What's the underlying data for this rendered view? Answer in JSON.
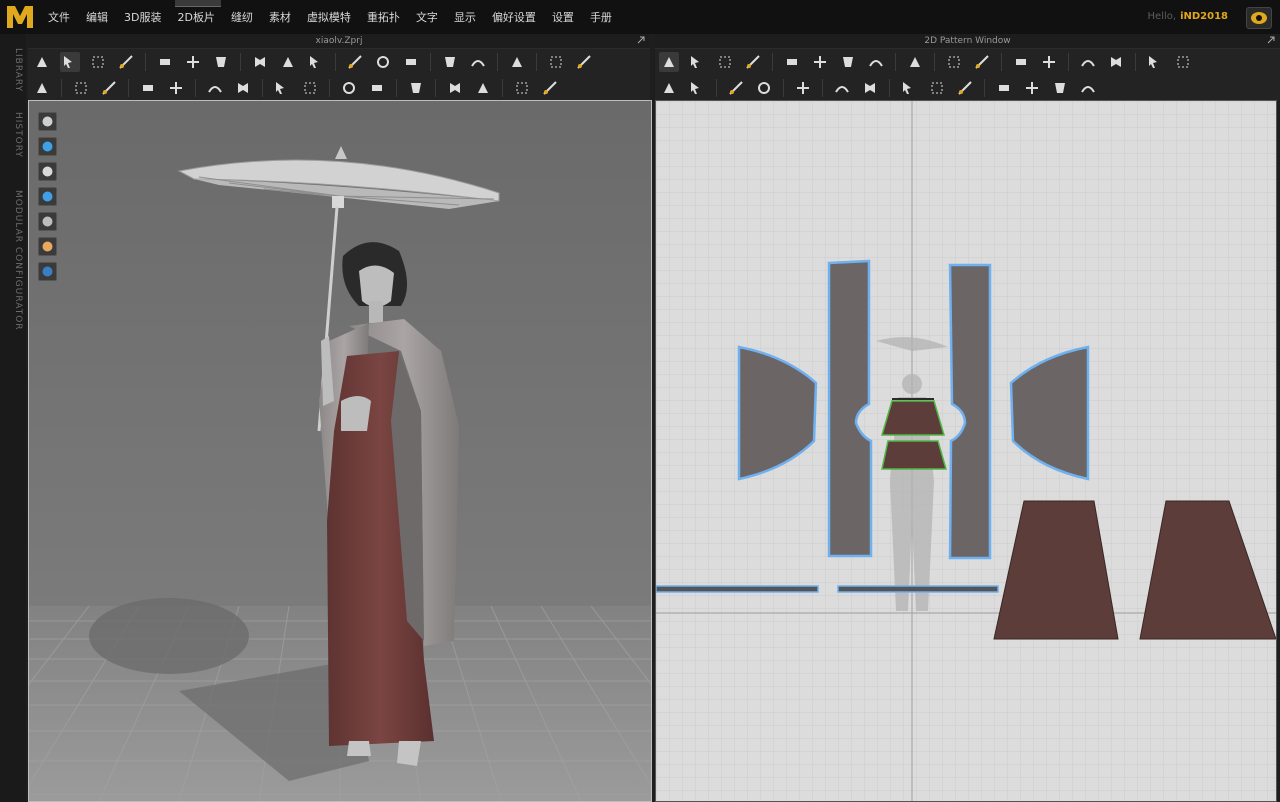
{
  "app": {
    "logo_icon": "marvelous-logo-icon",
    "menu": [
      "文件",
      "编辑",
      "3D服装",
      "2D板片",
      "缝纫",
      "素材",
      "虚拟模特",
      "重拓扑",
      "文字",
      "显示",
      "偏好设置",
      "设置",
      "手册"
    ],
    "greeting": "Hello,",
    "username": "iND2018"
  },
  "sidebar": {
    "tabs": [
      "LIBRARY",
      "HISTORY",
      "MODULAR CONFIGURATOR"
    ]
  },
  "panels": {
    "left_title": "xiaolv.Zprj",
    "right_title": "2D Pattern Window"
  },
  "toolbar_3d": {
    "row1": [
      "select-move",
      "transform-pattern",
      "transform-point",
      "fold-arrangement",
      "_",
      "tack",
      "tack-on-avatar",
      "fold-tack",
      "_",
      "pin-3d",
      "pin-cut",
      "garment-copy",
      "_",
      "strap",
      "tape",
      "steam",
      "_",
      "flat-arrow",
      "flat-sphere",
      "_",
      "edit-fold",
      "_",
      "grid-pattern",
      "grid-line"
    ],
    "row2": [
      "avatar-pose",
      "_",
      "select-mesh",
      "edit-mesh",
      "_",
      "segment",
      "reset-3d",
      "_",
      "lock",
      "hide",
      "_",
      "show-arrangement",
      "show-pins",
      "_",
      "measure",
      "measure-line",
      "_",
      "strength",
      "_",
      "fabric",
      "edit-texture",
      "_",
      "puckering",
      "size"
    ]
  },
  "toolbar_2d": {
    "row1": [
      "select-pattern",
      "transform",
      "edit-curve",
      "edit-point",
      "_",
      "polygon",
      "rectangle",
      "ellipse",
      "internal-line",
      "_",
      "fold",
      "_",
      "fill",
      "texture",
      "_",
      "trace",
      "slide",
      "_",
      "segment-sewing",
      "free-sewing",
      "_",
      "grid-a",
      "grid-b"
    ],
    "row2": [
      "internal-polygon",
      "offset",
      "_",
      "lock-2d",
      "unlock",
      "_",
      "gather",
      "_",
      "symmetry",
      "topstitch",
      "_",
      "seam-a",
      "seam-b",
      "seam-c",
      "_",
      "line-tool",
      "dash-tool",
      "wave-tool",
      "zigzag-tool"
    ]
  },
  "viewport_tools": [
    "garment-icon",
    "particles-icon",
    "avatar-icon",
    "fabric-icon",
    "shadow-icon",
    "skin-icon",
    "globe-icon"
  ],
  "colors": {
    "accent": "#e0a81c",
    "pattern_fill": "#6b6665",
    "pattern_outline": "#6fb1f0",
    "sash_fill": "#5c3d3a",
    "seam_green": "#4fb845",
    "grid_bg": "#dcdcdc"
  }
}
